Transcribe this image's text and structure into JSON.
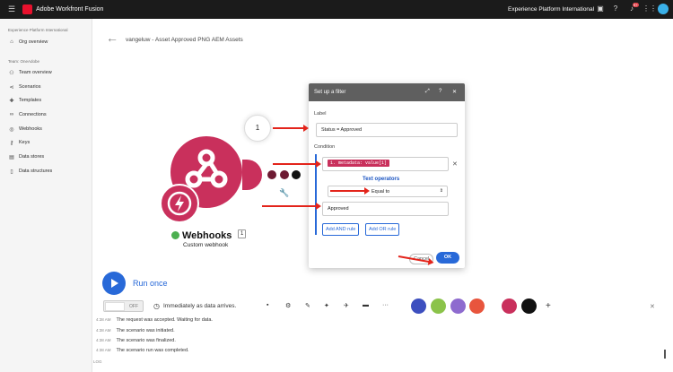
{
  "topbar": {
    "app_name": "Adobe Workfront Fusion",
    "org_name": "Experience Platform International",
    "notification_count": "9+"
  },
  "sidebar": {
    "org_section": "Experience Platform International",
    "org_overview": "Org overview",
    "team_section": "Team: OneAdobe",
    "items": [
      "Team overview",
      "Scenarios",
      "Templates",
      "Connections",
      "Webhooks",
      "Keys",
      "Data stores",
      "Data structures"
    ]
  },
  "scenario": {
    "title": "vangeluw - Asset Approved PNG AEM Assets",
    "bubble_count": "1",
    "module_name": "Webhooks",
    "module_count": "1",
    "module_subtitle": "Custom webhook"
  },
  "dialog": {
    "title": "Set up a filter",
    "label_heading": "Label",
    "label_value": "Status = Approved",
    "condition_heading": "Condition",
    "condition_tag": "1. metadata: value[1]",
    "operators_title": "Text operators",
    "operator_value": "Equal to",
    "value_field": "Approved",
    "add_and_rule": "Add AND rule",
    "add_or_rule": "Add OR rule",
    "cancel": "Cancel",
    "ok": "OK"
  },
  "controls": {
    "run_once": "Run once",
    "toggle_off": "OFF",
    "schedule": "Immediately as data arrives."
  },
  "log": [
    {
      "time": "4:38 AM",
      "text": "The request was accepted. Waiting for data."
    },
    {
      "time": "4:38 AM",
      "text": "The scenario was initiated."
    },
    {
      "time": "4:38 AM",
      "text": "The scenario was finalized."
    },
    {
      "time": "4:38 AM",
      "text": "The scenario run was completed."
    }
  ],
  "log_footer": "LOG",
  "colors": {
    "accent": "#2869d8",
    "webhook": "#c9305c",
    "annotation_arrow": "#e3241b"
  }
}
